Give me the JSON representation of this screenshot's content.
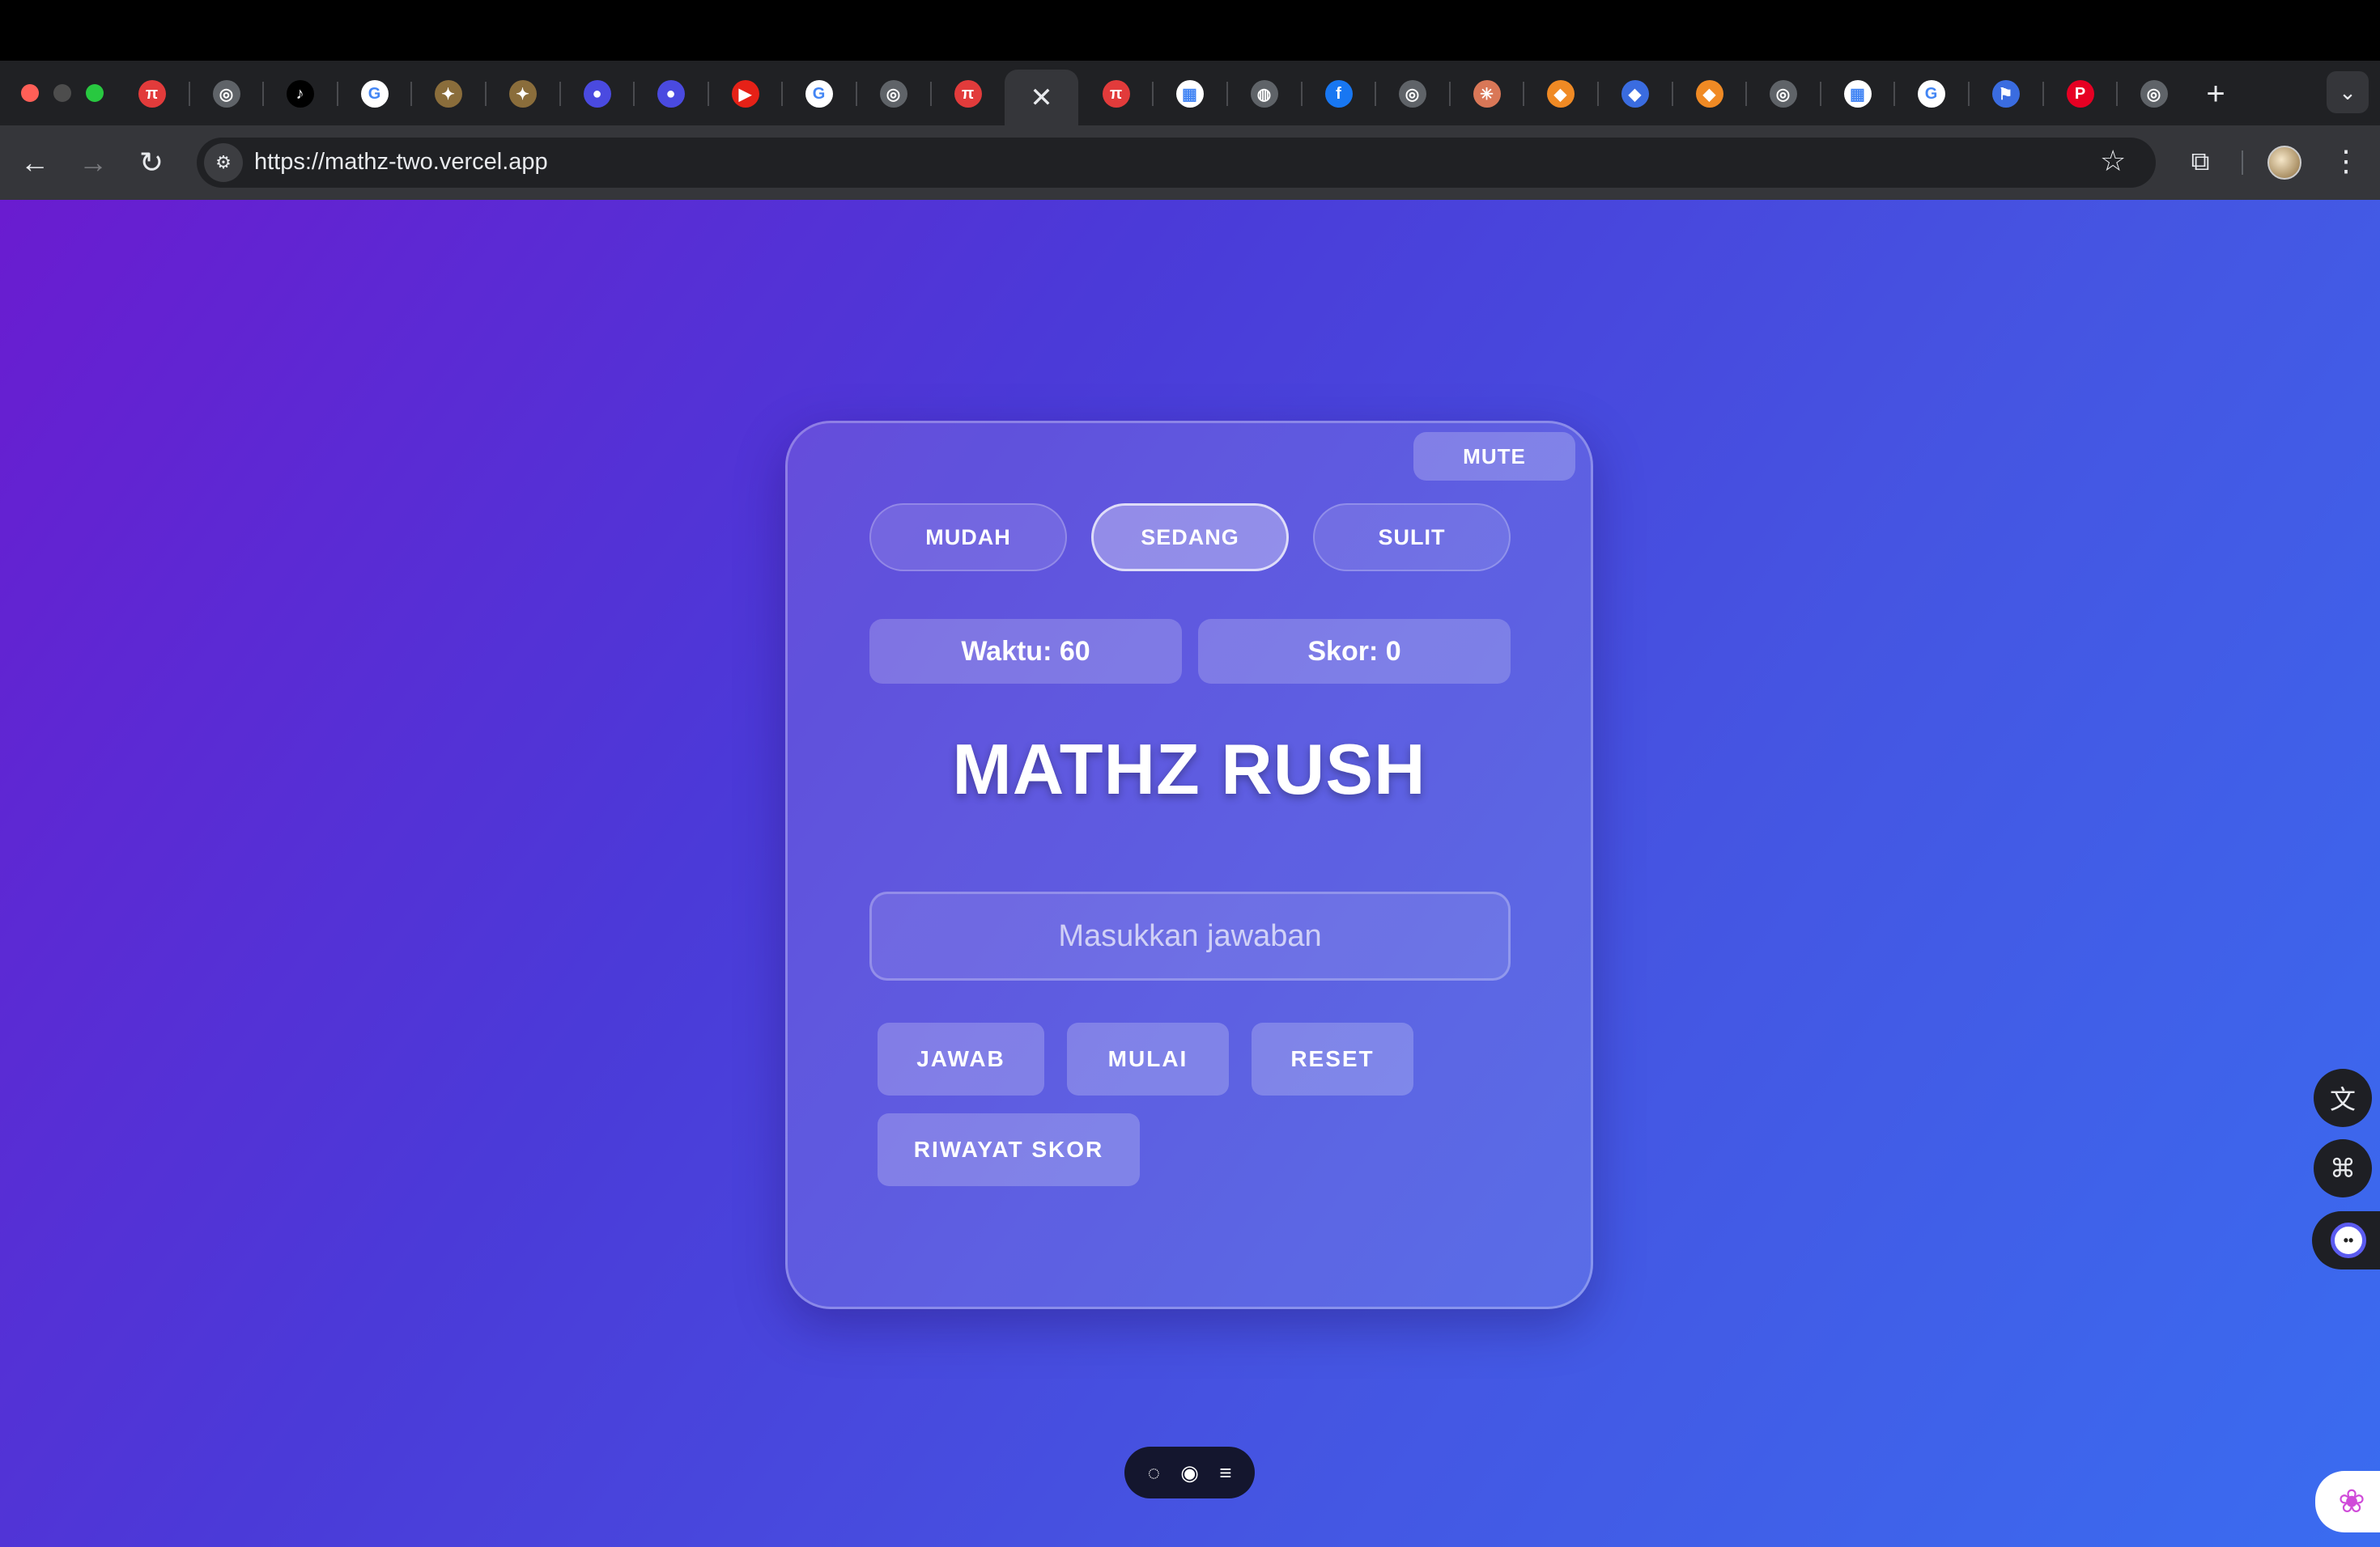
{
  "browser": {
    "tabs": [
      {
        "icon": "pi-app-icon",
        "glyph": "π",
        "color": "#e23b3b"
      },
      {
        "icon": "chatgpt-icon",
        "glyph": "◎",
        "color": "#5f6368"
      },
      {
        "icon": "tiktok-icon",
        "glyph": "♪",
        "color": "#000000"
      },
      {
        "icon": "google-icon",
        "glyph": "G",
        "color": "#ffffff"
      },
      {
        "icon": "pixel-cat-icon",
        "glyph": "✦",
        "color": "#8a6d3b"
      },
      {
        "icon": "pixel-cat-icon",
        "glyph": "✦",
        "color": "#8a6d3b"
      },
      {
        "icon": "mascot-icon",
        "glyph": "●",
        "color": "#4a4ae0"
      },
      {
        "icon": "mascot-icon",
        "glyph": "●",
        "color": "#4a4ae0"
      },
      {
        "icon": "youtube-icon",
        "glyph": "▶",
        "color": "#e62117"
      },
      {
        "icon": "google-icon",
        "glyph": "G",
        "color": "#ffffff"
      },
      {
        "icon": "chrome-icon",
        "glyph": "◎",
        "color": "#5f6368"
      },
      {
        "icon": "pi-app-icon",
        "glyph": "π",
        "color": "#e23b3b"
      },
      {
        "icon": "close-icon",
        "glyph": "✕",
        "color": "#35363a",
        "active": true
      },
      {
        "icon": "pi-app-icon",
        "glyph": "π",
        "color": "#e23b3b"
      },
      {
        "icon": "qr-icon",
        "glyph": "▦",
        "color": "#ffffff"
      },
      {
        "icon": "globe-icon",
        "glyph": "◍",
        "color": "#5f6368"
      },
      {
        "icon": "facebook-icon",
        "glyph": "f",
        "color": "#1877f2"
      },
      {
        "icon": "chrome-icon",
        "glyph": "◎",
        "color": "#5f6368"
      },
      {
        "icon": "claude-icon",
        "glyph": "✳",
        "color": "#d97757"
      },
      {
        "icon": "orange-shape-icon",
        "glyph": "◆",
        "color": "#f08a24"
      },
      {
        "icon": "blue-shape-icon",
        "glyph": "◆",
        "color": "#3a6ce0"
      },
      {
        "icon": "orange-shape-icon",
        "glyph": "◆",
        "color": "#f08a24"
      },
      {
        "icon": "chrome-icon",
        "glyph": "◎",
        "color": "#5f6368"
      },
      {
        "icon": "qr-icon",
        "glyph": "▦",
        "color": "#ffffff"
      },
      {
        "icon": "google-icon",
        "glyph": "G",
        "color": "#ffffff"
      },
      {
        "icon": "flag-icon",
        "glyph": "⚑",
        "color": "#3a6ce0"
      },
      {
        "icon": "pinterest-icon",
        "glyph": "P",
        "color": "#e60023"
      },
      {
        "icon": "chrome-icon",
        "glyph": "◎",
        "color": "#5f6368"
      }
    ],
    "url": "https://mathz-two.vercel.app"
  },
  "game": {
    "mute_label": "MUTE",
    "difficulty": {
      "easy": "MUDAH",
      "medium": "SEDANG",
      "hard": "SULIT",
      "selected": "medium"
    },
    "timer": "Waktu: 60",
    "score": "Skor: 0",
    "title": "MATHZ RUSH",
    "answer_placeholder": "Masukkan jawaban",
    "answer_value": "",
    "buttons": {
      "answer": "JAWAB",
      "start": "MULAI",
      "reset": "RESET",
      "history": "RIWAYAT SKOR"
    }
  },
  "colors": {
    "gradient_start": "#6a1cd0",
    "gradient_end": "#3a6cf0"
  }
}
